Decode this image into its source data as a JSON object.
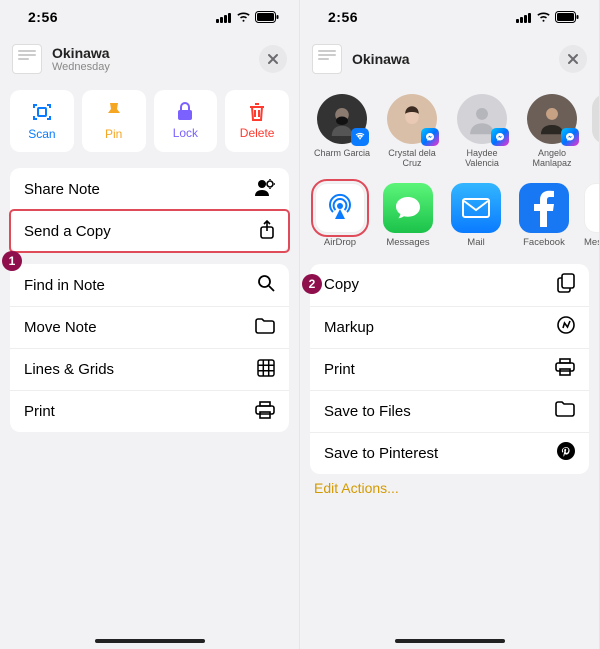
{
  "status": {
    "time": "2:56"
  },
  "header": {
    "title": "Okinawa",
    "subtitle": "Wednesday"
  },
  "quick": {
    "scan": "Scan",
    "pin": "Pin",
    "lock": "Lock",
    "del": "Delete"
  },
  "rowsA": {
    "share": "Share Note",
    "send": "Send a Copy"
  },
  "rowsB": {
    "find": "Find in Note",
    "move": "Move Note",
    "lines": "Lines & Grids",
    "print": "Print"
  },
  "share": {
    "contacts": [
      {
        "name": "Charm Garcia"
      },
      {
        "name": "Crystal dela Cruz"
      },
      {
        "name": "Haydee Valencia"
      },
      {
        "name": "Angelo Manlapaz"
      }
    ],
    "apps": [
      {
        "id": "airdrop",
        "label": "AirDrop"
      },
      {
        "id": "messages",
        "label": "Messages"
      },
      {
        "id": "mail",
        "label": "Mail"
      },
      {
        "id": "facebook",
        "label": "Facebook"
      },
      {
        "id": "messenger",
        "label": "Mes…"
      }
    ],
    "actions": {
      "copy": "Copy",
      "markup": "Markup",
      "print": "Print",
      "save_files": "Save to Files",
      "save_pinterest": "Save to Pinterest"
    },
    "edit": "Edit Actions..."
  },
  "annotations": {
    "m1": "1",
    "m2": "2"
  }
}
